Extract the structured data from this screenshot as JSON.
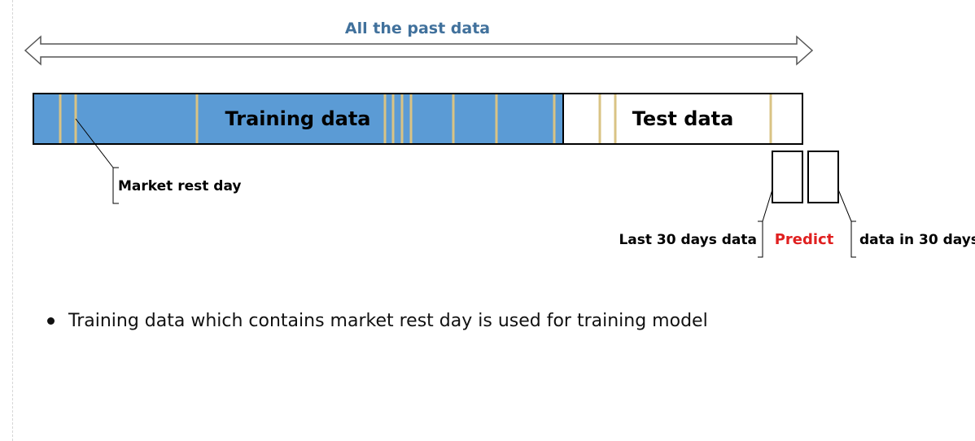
{
  "top_label": "All the past data",
  "training_label": "Training data",
  "test_label": "Test data",
  "rest_day_label": "Market rest day",
  "last_days_label": "Last 30 days data",
  "predict_label": "Predict",
  "future_label": "data in 30 days",
  "bullet_text": "Training data which contains market rest day is used for training model",
  "colors": {
    "training_fill": "#5b9bd5",
    "rest_day_marker": "#d9c384",
    "top_label": "#41719c",
    "predict": "#e02020"
  }
}
